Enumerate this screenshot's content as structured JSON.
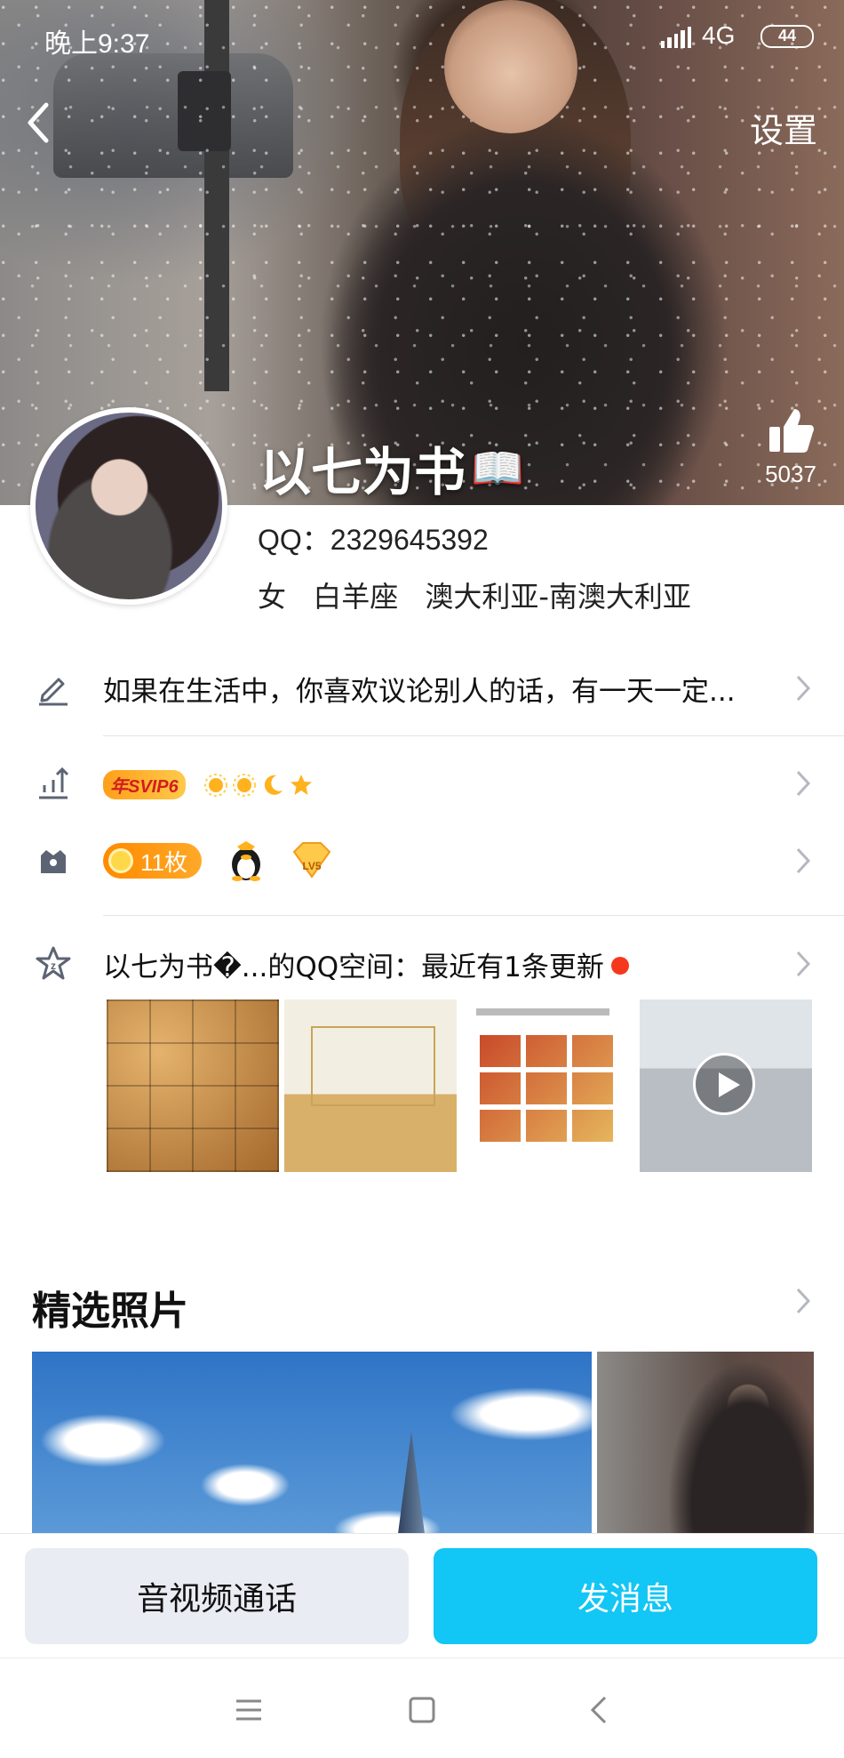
{
  "status_bar": {
    "time": "晚上9:37",
    "network": "4G",
    "battery": "44"
  },
  "header": {
    "settings_label": "设置",
    "like_count": "5037"
  },
  "profile": {
    "nickname": "以七为书",
    "qq": "QQ：2329645392",
    "gender": "女",
    "zodiac": "白羊座",
    "location": "澳大利亚-南澳大利亚"
  },
  "rows": {
    "signature": "如果在生活中，你喜欢议论别人的话，有一天一定...",
    "vip_label": "年SVIP6",
    "medal_count": "11枚",
    "level_badge": "LV5",
    "qzone": "以七为书�...的QQ空间：最近有1条更新"
  },
  "featured": {
    "title": "精选照片"
  },
  "actions": {
    "call_label": "音视频通话",
    "message_label": "发消息"
  },
  "colors": {
    "accent": "#12c6f5",
    "call_bg": "#eaecf3",
    "vip_orange": "#ff9f1a",
    "dot_red": "#f5381d"
  },
  "icons": {
    "back": "back-arrow-icon",
    "like": "thumbs-up-icon",
    "edit": "pencil-icon",
    "level": "bar-chart-icon",
    "gift": "gift-box-icon",
    "qzone": "qzone-star-icon",
    "chevron": "chevron-right-icon"
  }
}
